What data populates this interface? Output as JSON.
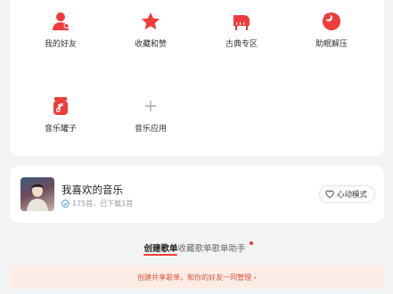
{
  "shortcuts": [
    {
      "label": "我的好友",
      "icon": "friends-icon"
    },
    {
      "label": "收藏和赞",
      "icon": "star-icon"
    },
    {
      "label": "古典专区",
      "icon": "piano-icon"
    },
    {
      "label": "助眠解压",
      "icon": "moon-icon"
    },
    {
      "label": "音乐罐子",
      "icon": "music-jar-icon"
    },
    {
      "label": "音乐应用",
      "icon": "plus-icon"
    }
  ],
  "liked_playlist": {
    "title": "我喜欢的音乐",
    "subtitle": "175首，已下载1首",
    "mode_label": "心动模式"
  },
  "tabs": [
    {
      "label": "创建歌单",
      "active": true
    },
    {
      "label": "收藏歌单",
      "active": false
    },
    {
      "label": "歌单助手",
      "active": false
    }
  ],
  "banner": {
    "text": "创建共享歌单，和你的好友一同管理 ›"
  },
  "colors": {
    "accent": "#ef3b3b",
    "background": "#f2f3f5"
  }
}
